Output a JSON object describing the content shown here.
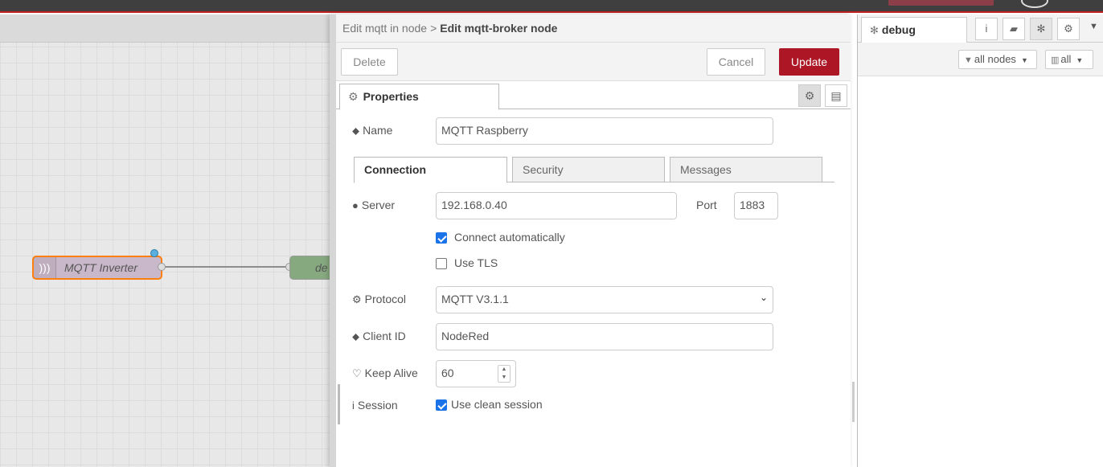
{
  "workspace": {
    "flow_nodes": [
      {
        "label": "MQTT Inverter"
      },
      {
        "label": "de"
      }
    ]
  },
  "editor": {
    "breadcrumb": {
      "parent": "Edit mqtt in node",
      "separator": ">",
      "current": "Edit mqtt-broker node"
    },
    "toolbar": {
      "delete_label": "Delete",
      "cancel_label": "Cancel",
      "update_label": "Update"
    },
    "tab_properties": "Properties",
    "fields": {
      "name": {
        "label": "Name",
        "value": "MQTT Raspberry"
      },
      "connection_tabs": [
        "Connection",
        "Security",
        "Messages"
      ],
      "server": {
        "label": "Server",
        "value": "192.168.0.40"
      },
      "port": {
        "label": "Port",
        "value": "1883"
      },
      "connect_automatically": {
        "label": "Connect automatically",
        "checked": true
      },
      "use_tls": {
        "label": "Use TLS",
        "checked": false
      },
      "protocol": {
        "label": "Protocol",
        "value": "MQTT V3.1.1"
      },
      "client_id": {
        "label": "Client ID",
        "value": "NodeRed"
      },
      "keep_alive": {
        "label": "Keep Alive",
        "value": "60"
      },
      "session": {
        "label": "Session",
        "option_label": "Use clean session",
        "checked": true
      }
    }
  },
  "sidebar": {
    "active_tab": "debug",
    "filter_nodes": "all nodes",
    "clear_all": "all"
  },
  "colors": {
    "accent_update": "#ad1625",
    "header_bg": "#3f3f3f",
    "mqtt_node": "#c9b8c9",
    "debug_node": "#87a980",
    "selection": "#ff7f0e",
    "checkbox": "#1a73e8"
  },
  "icons": {
    "tag": "tag-icon",
    "globe": "globe-icon",
    "gear": "gear-icon",
    "heartbeat": "heartbeat-icon",
    "info": "info-icon",
    "bug": "bug-icon",
    "book": "book-icon",
    "filter": "filter-icon",
    "trash": "trash-icon",
    "document": "document-icon"
  }
}
